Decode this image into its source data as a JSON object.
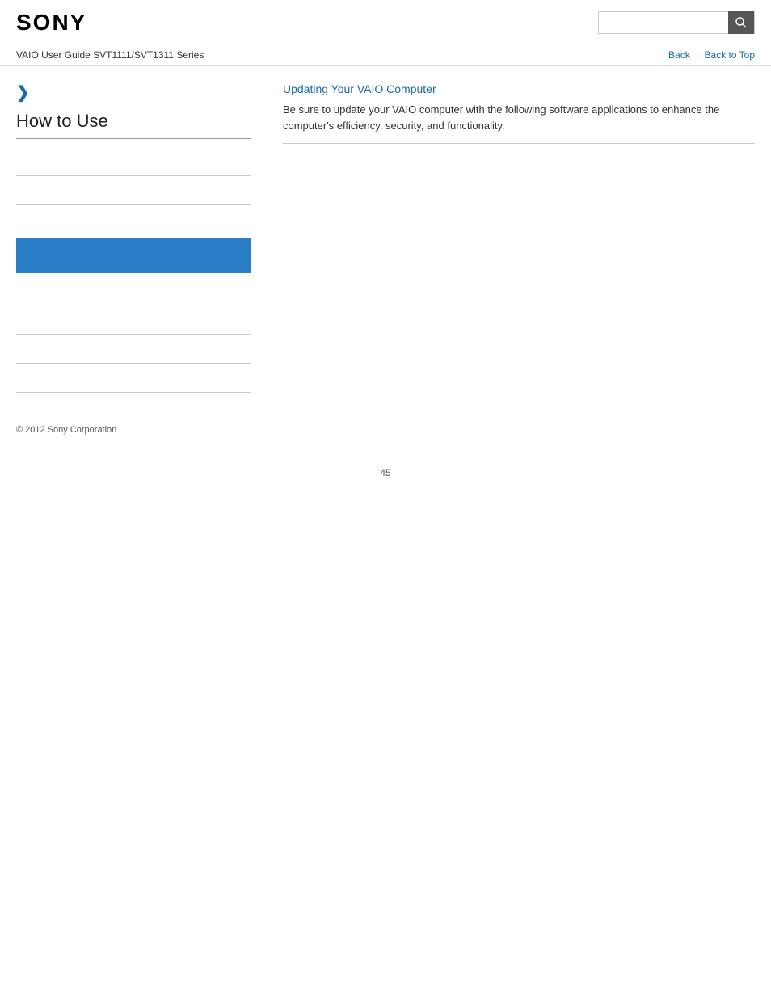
{
  "header": {
    "logo": "SONY",
    "search_placeholder": "",
    "search_icon": "🔍"
  },
  "sub_header": {
    "guide_title": "VAIO User Guide SVT1111/SVT1311 Series",
    "nav": {
      "back_label": "Back",
      "separator": "|",
      "back_to_top_label": "Back to Top"
    }
  },
  "sidebar": {
    "chevron": "❯",
    "section_title": "How to Use",
    "items": [
      {
        "label": "",
        "type": "blank"
      },
      {
        "label": "",
        "type": "blank"
      },
      {
        "label": "",
        "type": "blank"
      },
      {
        "label": "",
        "type": "highlight"
      },
      {
        "label": "",
        "type": "blank"
      },
      {
        "label": "",
        "type": "blank"
      },
      {
        "label": "",
        "type": "blank"
      },
      {
        "label": "",
        "type": "blank"
      }
    ]
  },
  "content": {
    "link_label": "Updating Your VAIO Computer",
    "description": "Be sure to update your VAIO computer with the following software applications to enhance the computer's efficiency, security, and functionality."
  },
  "footer": {
    "copyright": "© 2012 Sony Corporation"
  },
  "page_number": "45"
}
